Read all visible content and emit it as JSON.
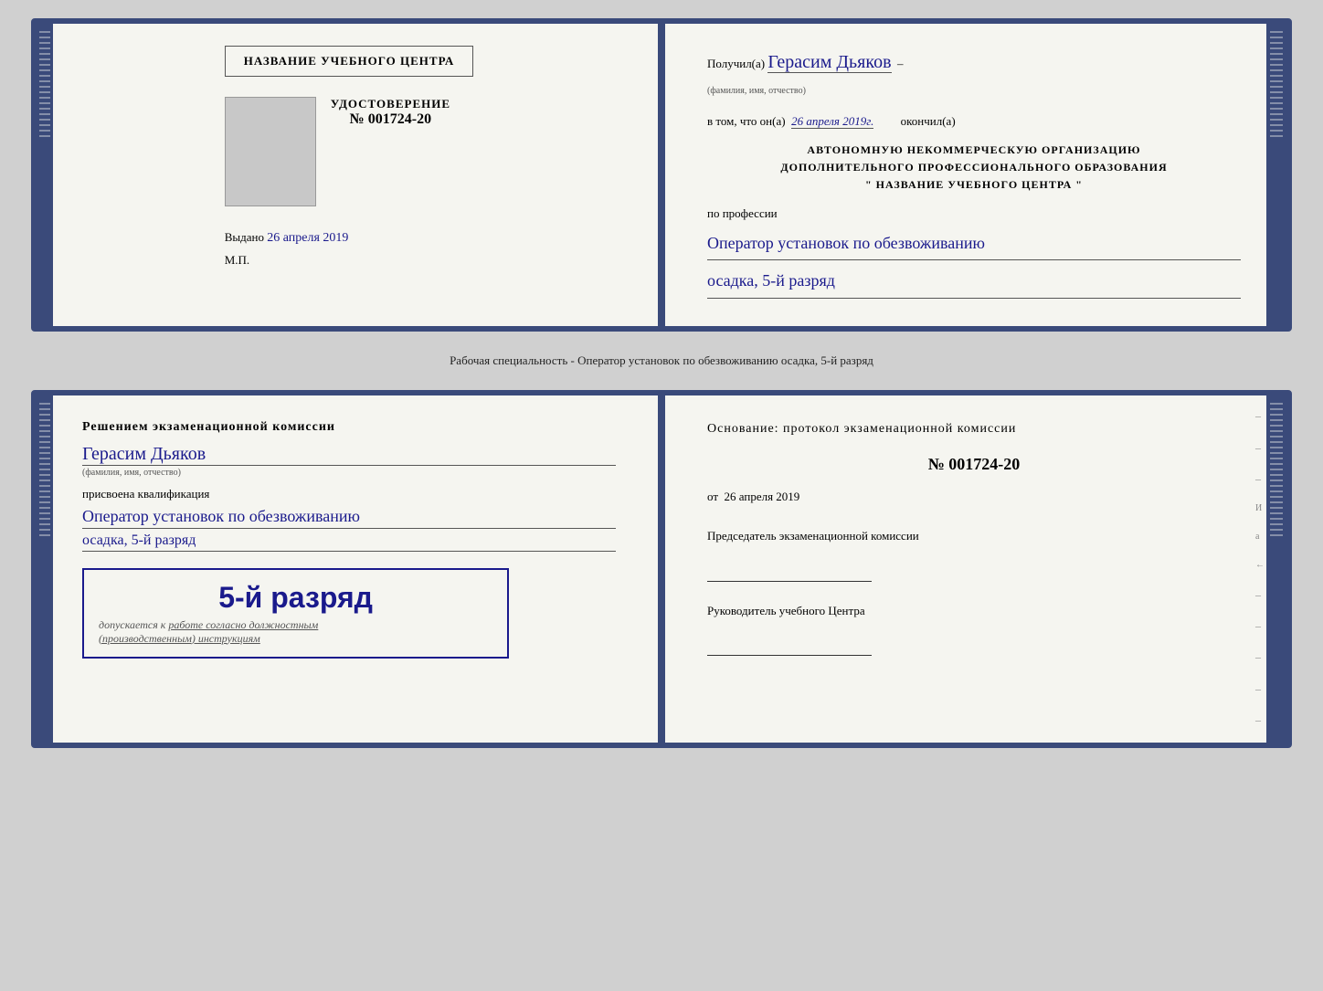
{
  "page": {
    "background": "#d0d0d0"
  },
  "top_cert": {
    "left": {
      "school_name": "НАЗВАНИЕ УЧЕБНОГО ЦЕНТРА",
      "doc_label": "УДОСТОВЕРЕНИЕ",
      "doc_number": "№ 001724-20",
      "issued_label": "Выдано",
      "issued_date": "26 апреля 2019",
      "mp_label": "М.П."
    },
    "right": {
      "received_label": "Получил(а)",
      "recipient_name": "Герасим Дьяков",
      "recipient_subtitle": "(фамилия, имя, отчество)",
      "completed_prefix": "в том, что он(а)",
      "completed_date": "26 апреля 2019г.",
      "completed_suffix": "окончил(а)",
      "org_line1": "АВТОНОМНУЮ НЕКОММЕРЧЕСКУЮ ОРГАНИЗАЦИЮ",
      "org_line2": "ДОПОЛНИТЕЛЬНОГО ПРОФЕССИОНАЛЬНОГО ОБРАЗОВАНИЯ",
      "org_line3": "\" НАЗВАНИЕ УЧЕБНОГО ЦЕНТРА \"",
      "profession_label": "по профессии",
      "profession_value": "Оператор установок по обезвоживанию",
      "profession_extra": "осадка, 5-й разряд"
    }
  },
  "middle": {
    "caption": "Рабочая специальность - Оператор установок по обезвоживанию осадка, 5-й разряд"
  },
  "bottom_cert": {
    "left": {
      "commission_heading": "Решением экзаменационной комиссии",
      "person_name": "Герасим Дьяков",
      "person_subtitle": "(фамилия, имя, отчество)",
      "qualification_label": "присвоена квалификация",
      "qualification_value": "Оператор установок по обезвоживанию",
      "qualification_extra": "осадка, 5-й разряд",
      "rank_label": "5-й разряд",
      "allowed_prefix": "допускается к",
      "allowed_text": "работе согласно должностным",
      "allowed_text2": "(производственным) инструкциям"
    },
    "right": {
      "basis_label": "Основание: протокол экзаменационной комиссии",
      "protocol_number": "№ 001724-20",
      "protocol_date_prefix": "от",
      "protocol_date": "26 апреля 2019",
      "chairman_label": "Председатель экзаменационной комиссии",
      "center_head_label": "Руководитель учебного Центра"
    }
  }
}
